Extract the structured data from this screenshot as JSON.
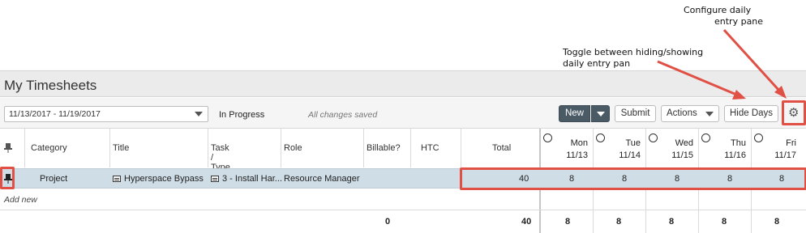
{
  "annotations": {
    "configure_line1": "Configure daily",
    "configure_line2": "entry pane",
    "toggle_line1": "Toggle between hiding/showing",
    "toggle_line2": "daily entry pan"
  },
  "header": {
    "title": "My Timesheets"
  },
  "toolbar": {
    "date_range": "11/13/2017 - 11/19/2017",
    "status": "In Progress",
    "saved_text": "All changes saved",
    "new_label": "New",
    "submit_label": "Submit",
    "actions_label": "Actions",
    "hide_days_label": "Hide Days",
    "gear_icon": "gear-icon"
  },
  "columns": {
    "category": "Category",
    "title": "Title",
    "task": "Task / Type",
    "role": "Role",
    "billable": "Billable?",
    "htc": "HTC",
    "total": "Total"
  },
  "days": [
    {
      "name": "Mon",
      "date": "11/13"
    },
    {
      "name": "Tue",
      "date": "11/14"
    },
    {
      "name": "Wed",
      "date": "11/15"
    },
    {
      "name": "Thu",
      "date": "11/16"
    },
    {
      "name": "Fri",
      "date": "11/17"
    }
  ],
  "row": {
    "category": "Project",
    "title": "Hyperspace Bypass",
    "task": "3 - Install Har...",
    "role": "Resource Manager",
    "total": "40",
    "hours": [
      "8",
      "8",
      "8",
      "8",
      "8"
    ]
  },
  "add_new": "Add new",
  "totals": {
    "billable": "0",
    "total": "40",
    "days": [
      "8",
      "8",
      "8",
      "8",
      "8"
    ]
  },
  "colors": {
    "highlight": "#e05045",
    "selected_row": "#cfdde6",
    "new_button": "#4a5b66"
  }
}
